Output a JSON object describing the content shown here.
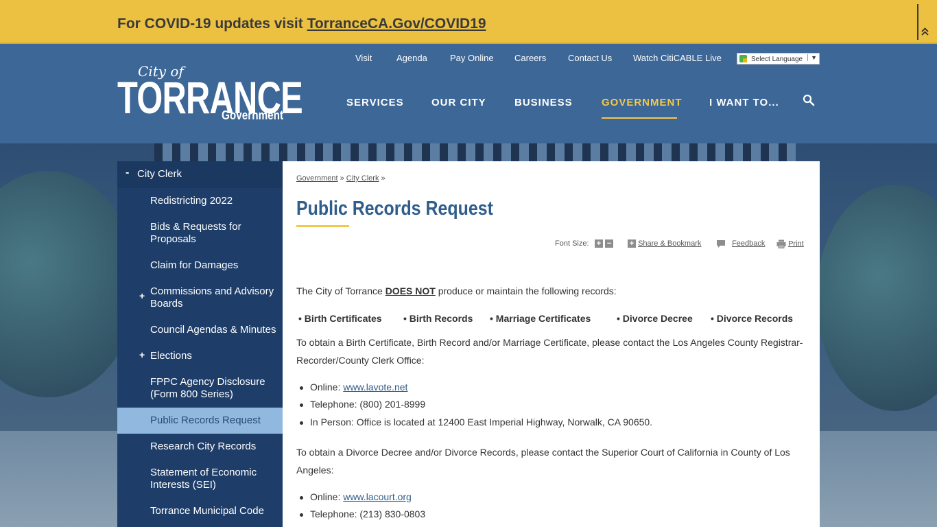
{
  "covid": {
    "prefix": "For COVID-19 updates visit ",
    "link": "TorranceCA.Gov/COVID19",
    "collapse_icon": "double-chevron-up-icon"
  },
  "logo": {
    "city_of": "City of",
    "name": "TORRANCE",
    "sub": "Government"
  },
  "utility_nav": [
    "Visit",
    "Agenda",
    "Pay Online",
    "Careers",
    "Contact Us",
    "Watch CitiCABLE Live"
  ],
  "language": {
    "label": "Select Language",
    "arrow": "▼"
  },
  "main_nav": [
    "SERVICES",
    "OUR CITY",
    "BUSINESS",
    "GOVERNMENT",
    "I WANT TO..."
  ],
  "main_nav_active": "GOVERNMENT",
  "sidebar": {
    "parent_toggle": "-",
    "parent": "City Clerk",
    "items": [
      {
        "label": "Redistricting 2022",
        "toggle": ""
      },
      {
        "label": "Bids & Requests for Proposals",
        "toggle": ""
      },
      {
        "label": "Claim for Damages",
        "toggle": ""
      },
      {
        "label": "Commissions and Advisory Boards",
        "toggle": "+"
      },
      {
        "label": "Council Agendas & Minutes",
        "toggle": ""
      },
      {
        "label": "Elections",
        "toggle": "+"
      },
      {
        "label": "FPPC Agency Disclosure (Form 800 Series)",
        "toggle": ""
      },
      {
        "label": "Public Records Request",
        "toggle": ""
      },
      {
        "label": "Research City Records",
        "toggle": ""
      },
      {
        "label": "Statement of Economic Interests (SEI)",
        "toggle": ""
      },
      {
        "label": "Torrance Municipal Code",
        "toggle": ""
      }
    ],
    "current": "Public Records Request"
  },
  "breadcrumb": {
    "items": [
      "Government",
      "City Clerk"
    ],
    "sep": "»"
  },
  "page_title": "Public Records Request",
  "tools": {
    "font_size_label": "Font Size:",
    "increase": "+",
    "decrease": "−",
    "share_label": "Share & Bookmark",
    "feedback_label": "Feedback",
    "print_label": "Print"
  },
  "content": {
    "intro_before": "The City of Torrance ",
    "intro_emphasis": "DOES NOT",
    "intro_after": " produce or maintain the following records:",
    "record_types": [
      "• Birth Certificates",
      "• Birth Records",
      "• Marriage Certificates",
      "• Divorce Decree",
      "• Divorce Records"
    ],
    "birth_para": "To obtain a Birth Certificate, Birth Record and/or Marriage Certificate, please contact the Los Angeles County Registrar-Recorder/County Clerk Office:",
    "birth_online_label": "Online: ",
    "birth_online_link": "www.lavote.net",
    "birth_phone": "Telephone: (800) 201-8999",
    "birth_inperson": "In Person: Office is located at 12400 East Imperial Highway, Norwalk, CA 90650.",
    "divorce_para": "To obtain a Divorce Decree and/or Divorce Records, please contact the Superior Court of California in County of Los Angeles:",
    "divorce_online_label": "Online: ",
    "divorce_online_link": "www.lacourt.org",
    "divorce_phone": "Telephone: (213) 830-0803"
  }
}
